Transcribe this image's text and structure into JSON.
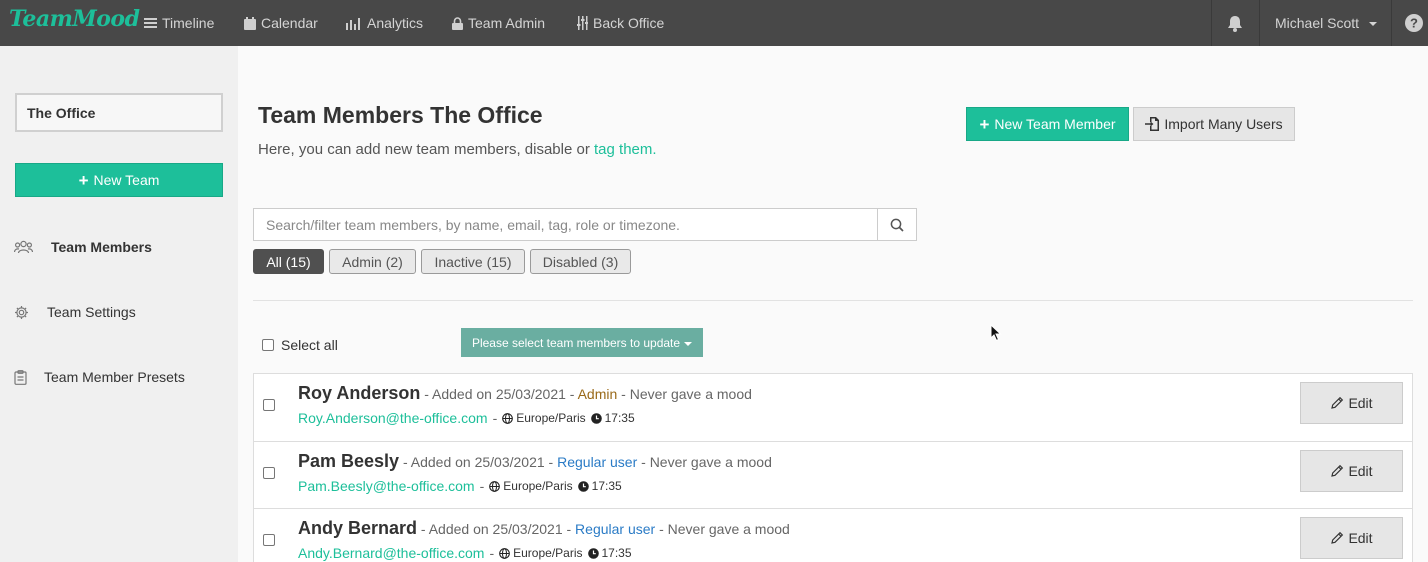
{
  "app": {
    "logo": "TeamMood"
  },
  "nav": {
    "items": [
      {
        "label": "Timeline",
        "icon": "list-icon"
      },
      {
        "label": "Calendar",
        "icon": "calendar-icon"
      },
      {
        "label": "Analytics",
        "icon": "analytics-icon"
      },
      {
        "label": "Team Admin",
        "icon": "lock-icon"
      },
      {
        "label": "Back Office",
        "icon": "sliders-icon"
      }
    ],
    "user": "Michael Scott"
  },
  "sidebar": {
    "team_name": "The Office",
    "new_team_label": "New Team",
    "items": [
      {
        "label": "Team Members",
        "icon": "users-icon",
        "active": true
      },
      {
        "label": "Team Settings",
        "icon": "gear-icon",
        "active": false
      },
      {
        "label": "Team Member Presets",
        "icon": "clipboard-icon",
        "active": false
      }
    ]
  },
  "main": {
    "title": "Team Members The Office",
    "subtitle_prefix": "Here, you can add new team members, disable or",
    "subtitle_link": "tag them.",
    "new_member_label": "New Team Member",
    "import_label": "Import Many Users",
    "search_placeholder": "Search/filter team members, by name, email, tag, role or timezone.",
    "filters": [
      {
        "label": "All (15)",
        "active": true
      },
      {
        "label": "Admin (2)",
        "active": false
      },
      {
        "label": "Inactive (15)",
        "active": false
      },
      {
        "label": "Disabled (3)",
        "active": false
      }
    ],
    "select_all_label": "Select all",
    "bulk_action_label": "Please select team members to update",
    "edit_label": "Edit"
  },
  "members": [
    {
      "name": "Roy Anderson",
      "added": "- Added on 25/03/2021 -",
      "role": "Admin",
      "role_type": "admin",
      "mood": "- Never gave a mood",
      "email": "Roy.Anderson@the-office.com",
      "timezone": "Europe/Paris",
      "time": "17:35"
    },
    {
      "name": "Pam Beesly",
      "added": "- Added on 25/03/2021 -",
      "role": "Regular user",
      "role_type": "user",
      "mood": "- Never gave a mood",
      "email": "Pam.Beesly@the-office.com",
      "timezone": "Europe/Paris",
      "time": "17:35"
    },
    {
      "name": "Andy Bernard",
      "added": "- Added on 25/03/2021 -",
      "role": "Regular user",
      "role_type": "user",
      "mood": "- Never gave a mood",
      "email": "Andy.Bernard@the-office.com",
      "timezone": "Europe/Paris",
      "time": "17:35"
    }
  ],
  "colors": {
    "brand": "#1dbf9a",
    "nav_bg": "#484848",
    "admin_role": "#9a6a1a",
    "user_role": "#2a7bc6"
  }
}
